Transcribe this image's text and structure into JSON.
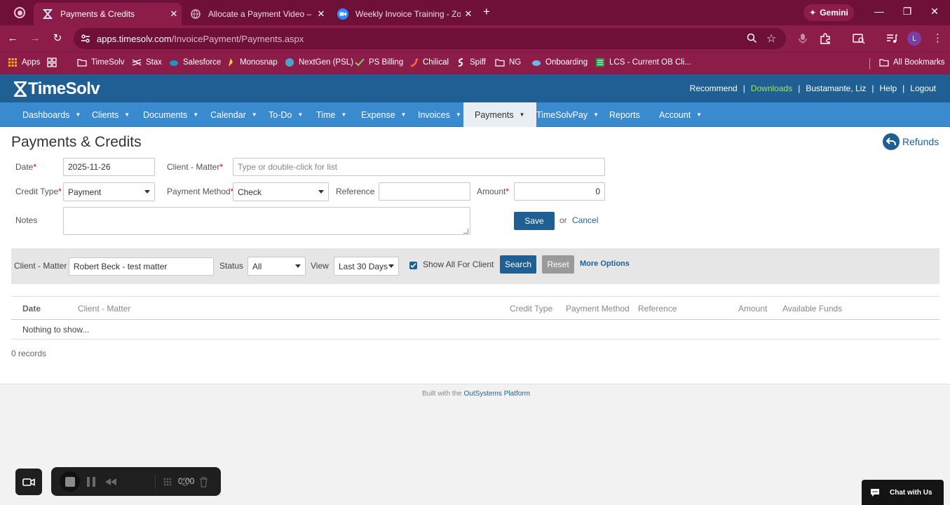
{
  "browser": {
    "tabs": [
      {
        "title": "Payments & Credits",
        "icon": "timesolv-icon",
        "active": true
      },
      {
        "title": "Allocate a Payment Video – Tim",
        "icon": "globe-icon",
        "active": false
      },
      {
        "title": "Weekly Invoice Training - Zoom",
        "icon": "zoom-icon",
        "active": false
      }
    ],
    "new_tab": "+",
    "gemini_label": "Gemini",
    "url_host": "apps.timesolv.com",
    "url_path": "/InvoicePayment/Payments.aspx",
    "profile_initial": "L",
    "bookmarks": [
      {
        "label": "Apps",
        "icon": "apps-grid-icon"
      },
      {
        "label": "",
        "icon": "grid-icon"
      },
      {
        "label": "TimeSolv",
        "icon": "folder-icon"
      },
      {
        "label": "Stax",
        "icon": "stax-icon"
      },
      {
        "label": "Salesforce",
        "icon": "cloud-icon"
      },
      {
        "label": "Monosnap",
        "icon": "monosnap-icon"
      },
      {
        "label": "NextGen (PSL)",
        "icon": "nextgen-icon"
      },
      {
        "label": "PS Billing",
        "icon": "check-icon"
      },
      {
        "label": "Chilical",
        "icon": "chili-icon"
      },
      {
        "label": "Spiff",
        "icon": "spiff-icon"
      },
      {
        "label": "NG",
        "icon": "folder-icon"
      },
      {
        "label": "Onboarding",
        "icon": "cloud-icon"
      },
      {
        "label": "LCS - Current OB Cli...",
        "icon": "sheet-icon"
      }
    ],
    "all_bookmarks": "All Bookmarks",
    "colors": {
      "tabbar": "#6e1038",
      "toolbar": "#8c1d48"
    }
  },
  "app": {
    "logo_text": "TimeSolv",
    "top_links": [
      "Recommend",
      "Downloads",
      "Bustamante, Liz",
      "Help",
      "Logout"
    ],
    "nav": [
      "Dashboards",
      "Clients",
      "Documents",
      "Calendar",
      "To-Do",
      "Time",
      "Expense",
      "Invoices",
      "Payments",
      "TimeSolvPay",
      "Reports",
      "Account"
    ],
    "nav_active": "Payments",
    "colors": {
      "header": "#1f5f93",
      "nav": "#3a8ad0",
      "accent": "#1f5f93",
      "downloads": "#9be26a"
    }
  },
  "page": {
    "title": "Payments & Credits",
    "refunds_label": "Refunds",
    "form": {
      "date_label": "Date",
      "date_value": "2025-11-26",
      "client_matter_label": "Client - Matter",
      "client_matter_placeholder": "Type or double-click for list",
      "credit_type_label": "Credit Type",
      "credit_type_value": "Payment",
      "payment_method_label": "Payment Method",
      "payment_method_value": "Check",
      "reference_label": "Reference",
      "reference_value": "",
      "amount_label": "Amount",
      "amount_value": "0",
      "notes_label": "Notes",
      "notes_value": "",
      "required_mark": "*",
      "save_label": "Save",
      "or_text": "or",
      "cancel_label": "Cancel"
    },
    "filter": {
      "client_matter_label": "Client - Matter",
      "client_matter_value": "Robert Beck - test matter",
      "status_label": "Status",
      "status_value": "All",
      "view_label": "View",
      "view_value": "Last 30 Days",
      "show_all_label": "Show All For Client",
      "show_all_checked": true,
      "search_label": "Search",
      "reset_label": "Reset",
      "more_options_label": "More Options"
    },
    "table": {
      "columns": [
        "Date",
        "Client - Matter",
        "Credit Type",
        "Payment Method",
        "Reference",
        "Amount",
        "Available Funds"
      ],
      "empty_text": "Nothing to show...",
      "records_text": "0 records"
    },
    "footer": {
      "built_prefix": "Built with the",
      "built_link": "OutSystems Platform"
    }
  },
  "overlay": {
    "timer": "0:00",
    "chat_label": "Chat with Us"
  }
}
